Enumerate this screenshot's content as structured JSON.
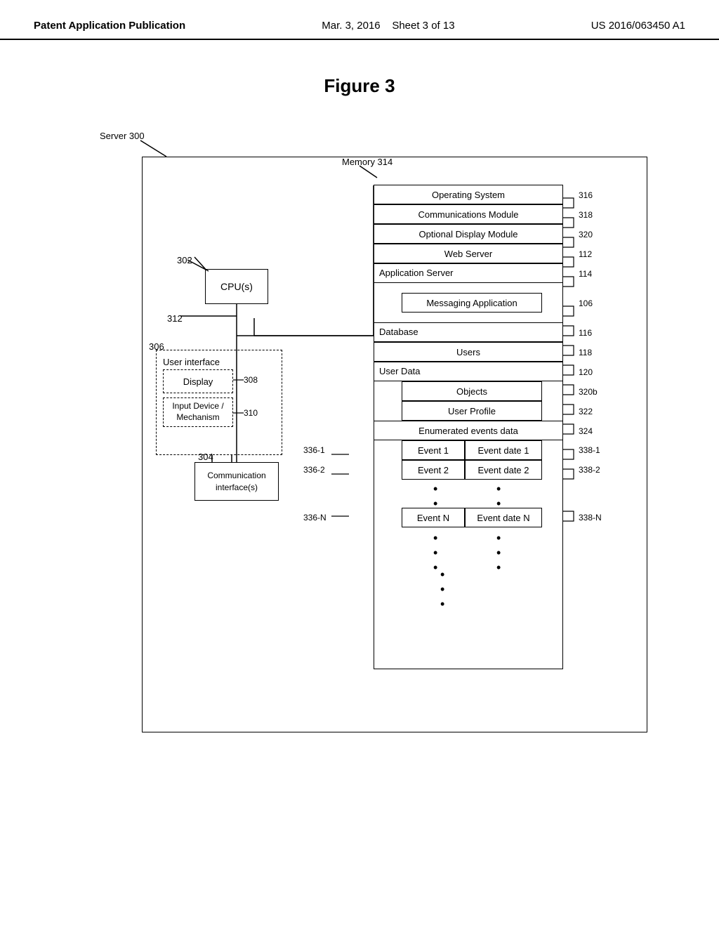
{
  "header": {
    "left": "Patent Application Publication",
    "center_date": "Mar. 3, 2016",
    "center_sheet": "Sheet 3 of 13",
    "right": "US 2016/063450 A1"
  },
  "figure": {
    "title": "Figure 3"
  },
  "labels": {
    "server": "Server 300",
    "memory": "Memory 314",
    "cpu_label": "302",
    "cpu_box": "CPU(s)",
    "comm_iface_label": "304",
    "comm_iface_box": "Communication\ninterface(s)",
    "bus_label": "312",
    "client_group_label": "306",
    "user_interface": "User interface",
    "display": "Display",
    "display_label": "308",
    "input_device": "Input Device /\nMechanism",
    "input_label": "310",
    "os_box": "Operating System",
    "os_ref": "316",
    "comm_module_box": "Communications Module",
    "comm_module_ref": "318",
    "opt_display_box": "Optional Display Module",
    "opt_display_ref": "320",
    "web_server_box": "Web Server",
    "web_server_ref": "112",
    "app_server_box": "Application Server",
    "app_server_ref": "114",
    "messaging_box": "Messaging Application",
    "messaging_ref": "106",
    "database_box": "Database",
    "database_ref": "116",
    "users_box": "Users",
    "users_ref": "118",
    "user_data_box": "User Data",
    "user_data_ref": "120",
    "objects_box": "Objects",
    "objects_ref": "320b",
    "user_profile_box": "User Profile",
    "user_profile_ref": "322",
    "enum_events_box": "Enumerated events data",
    "enum_events_ref": "324",
    "event1_box": "Event 1",
    "event1_date_box": "Event date 1",
    "event1_ref": "336-1",
    "event1_date_ref": "338-1",
    "event2_box": "Event 2",
    "event2_date_box": "Event date 2",
    "event2_ref": "336-2",
    "event2_date_ref": "338-2",
    "eventN_box": "Event N",
    "eventN_date_box": "Event date N",
    "eventN_ref": "336-N",
    "eventN_date_ref": "338-N"
  }
}
